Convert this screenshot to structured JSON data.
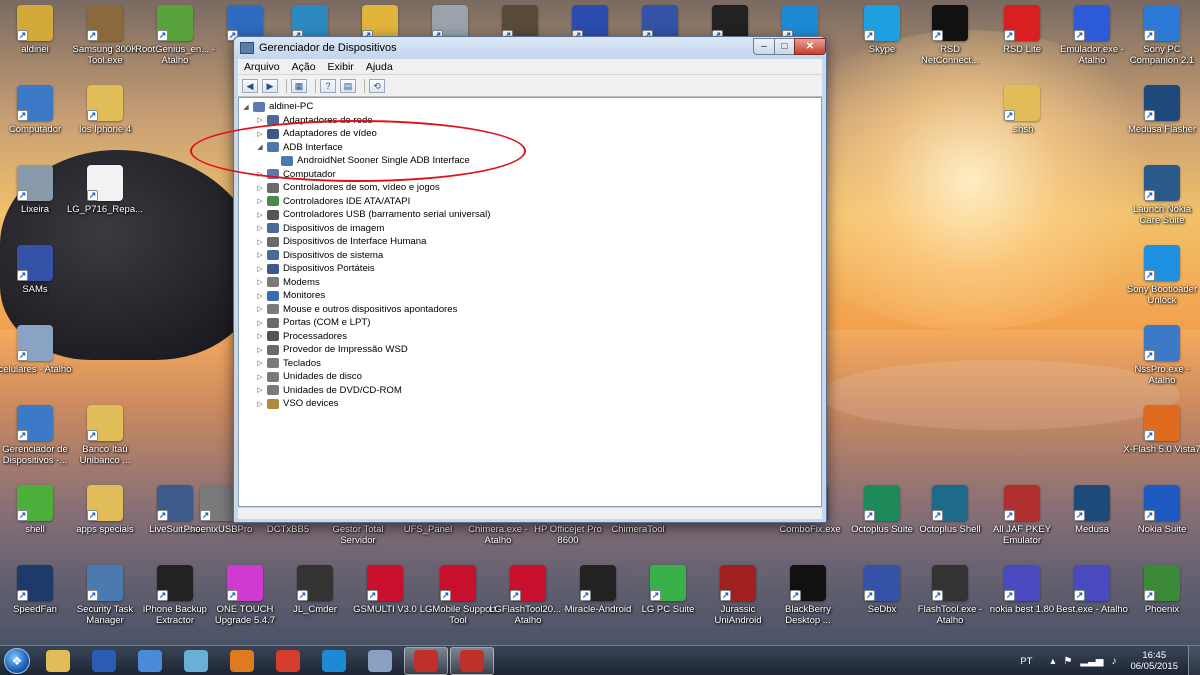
{
  "desktop_icons_left": [
    {
      "label": "aldinei",
      "icon": "user-folder-icon",
      "color": "#d4a93c"
    },
    {
      "label": "Samsung 300K Tool.exe",
      "icon": "resistor-icon",
      "color": "#8a6a3c"
    },
    {
      "label": "RootGenius_en... - Atalho",
      "icon": "android-icon",
      "color": "#5aa33c"
    },
    {
      "label": "Computador",
      "icon": "computer-icon",
      "color": "#3c7ac7"
    },
    {
      "label": "Ios Iphone 4",
      "icon": "folder-icon",
      "color": "#e1bd5a"
    },
    {
      "label": "Lixeira",
      "icon": "recycle-bin-icon",
      "color": "#8a9aab"
    },
    {
      "label": "LG_P716_Repa...",
      "icon": "document-icon",
      "color": "#f2f2f2"
    },
    {
      "label": "SAMs",
      "icon": "ds310-icon",
      "color": "#3352a8"
    },
    {
      "label": "celulares - Atalho",
      "icon": "phone-icon",
      "color": "#8aa2c4"
    },
    {
      "label": "Gerenciador de Dispositivos -...",
      "icon": "device-manager-icon",
      "color": "#3c7ac7"
    },
    {
      "label": "Banco Itaú Unibanco ...",
      "icon": "folder-icon",
      "color": "#e1bd5a"
    },
    {
      "label": "shell",
      "icon": "play-icon",
      "color": "#4caf3c"
    },
    {
      "label": "apps speciais",
      "icon": "folder-icon",
      "color": "#e1bd5a"
    },
    {
      "label": "LiveSuit.exe",
      "icon": "livesuit-icon",
      "color": "#3c5a8a"
    }
  ],
  "desktop_icons_top": [
    {
      "label": "",
      "icon": "anchor-icon",
      "color": "#2d6cc0"
    },
    {
      "label": "",
      "icon": "refresh-lock-icon",
      "color": "#2d8ac0"
    },
    {
      "label": "",
      "icon": "lock-icon",
      "color": "#e1b53c"
    },
    {
      "label": "",
      "icon": "drive-icon",
      "color": "#9aa2ab"
    },
    {
      "label": "",
      "icon": "photo-icon",
      "color": "#5a4a3a"
    },
    {
      "label": "",
      "icon": "download-arrows-icon",
      "color": "#2d4cb0"
    },
    {
      "label": "",
      "icon": "ds310-icon",
      "color": "#3352a8"
    },
    {
      "label": "",
      "icon": "wrench-icon",
      "color": "#222222"
    },
    {
      "label": "",
      "icon": "flash-icon",
      "color": "#1e8ad6"
    },
    {
      "label": "Skype",
      "icon": "skype-icon",
      "color": "#1ea0e0"
    },
    {
      "label": "RSD NetConnect...",
      "icon": "motorola-icon",
      "color": "#111111"
    },
    {
      "label": "RSD Lite",
      "icon": "motorola-red-icon",
      "color": "#d82020"
    },
    {
      "label": "Emulador.exe - Atalho",
      "icon": "building-icon",
      "color": "#2d5ad6"
    },
    {
      "label": "Sony PC Companion 2.1",
      "icon": "sony-phone-icon",
      "color": "#2d7ad6"
    }
  ],
  "desktop_icons_right": [
    {
      "label": ".shsh",
      "icon": "folder-icon",
      "color": "#e1bd5a"
    },
    {
      "label": "Medusa Flasher",
      "icon": "medusa-icon",
      "color": "#1d4a7a"
    },
    {
      "label": "Launch Nokia Care Suite",
      "icon": "nokia-care-icon",
      "color": "#2a5a8a"
    },
    {
      "label": "Sony Bootloader Unlock",
      "icon": "unlock-icon",
      "color": "#1e90e0"
    },
    {
      "label": "NssPro.exe - Atalho",
      "icon": "nss-icon",
      "color": "#3c7ac7"
    },
    {
      "label": "X-Flash 5.0 Vista7",
      "icon": "xflash-icon",
      "color": "#e06a1e"
    },
    {
      "label": "Nokia Suite",
      "icon": "nokia-suite-icon",
      "color": "#1e5ac0"
    }
  ],
  "desktop_row_mid": [
    {
      "label": "PhoenixUSBPro",
      "icon": "app-icon",
      "color": "#7a7a7a"
    },
    {
      "label": "DCTxBB5",
      "icon": "app-icon",
      "color": "#7a7a7a"
    },
    {
      "label": "Gestor Total Servidor",
      "icon": "app-icon",
      "color": "#7a7a7a"
    },
    {
      "label": "UFS_Panel",
      "icon": "app-icon",
      "color": "#7a7a7a"
    },
    {
      "label": "Chimera.exe - Atalho",
      "icon": "app-icon",
      "color": "#7a7a7a"
    },
    {
      "label": "HP Officejet Pro 8600",
      "icon": "printer-icon",
      "color": "#7a7a7a"
    },
    {
      "label": "ChimeraTool",
      "icon": "app-icon",
      "color": "#7a7a7a"
    },
    {
      "label": "ComboFix.exe",
      "icon": "app-icon",
      "color": "#c03030"
    },
    {
      "label": "Octoplus Suite",
      "icon": "octoplus-icon",
      "color": "#1e8a5a"
    },
    {
      "label": "Octoplus Shell",
      "icon": "octoplus-shell-icon",
      "color": "#1e6a8a"
    },
    {
      "label": "All JAF PKEY Emulator",
      "icon": "jaf-icon",
      "color": "#b03030"
    },
    {
      "label": "Medusa",
      "icon": "medusa-icon",
      "color": "#1d4a7a"
    }
  ],
  "desktop_row_bottom": [
    {
      "label": "SpeedFan",
      "icon": "fan-icon",
      "color": "#1e3a6a"
    },
    {
      "label": "Security Task Manager",
      "icon": "magnifier-icon",
      "color": "#4a7ab0"
    },
    {
      "label": "iPhone Backup Extractor",
      "icon": "iphone-icon",
      "color": "#222222"
    },
    {
      "label": "ONE TOUCH Upgrade 5.4.7",
      "icon": "sparkle-icon",
      "color": "#d03ad0"
    },
    {
      "label": "JL_Cmder",
      "icon": "tools-icon",
      "color": "#333333"
    },
    {
      "label": "GSMULTI V3.0",
      "icon": "lg-icon",
      "color": "#c8102e"
    },
    {
      "label": "LGMobile Support Tool",
      "icon": "lg-icon",
      "color": "#c8102e"
    },
    {
      "label": "LGFlashTool20... - Atalho",
      "icon": "lg-icon",
      "color": "#c8102e"
    },
    {
      "label": "Miracle-Android",
      "icon": "wrench-icon",
      "color": "#222222"
    },
    {
      "label": "LG PC Suite",
      "icon": "lg-suite-icon",
      "color": "#3ab04a"
    },
    {
      "label": "Jurassic UniAndroid",
      "icon": "jurassic-icon",
      "color": "#a02020"
    },
    {
      "label": "BlackBerry Desktop ...",
      "icon": "blackberry-icon",
      "color": "#111111"
    },
    {
      "label": "SeDbx",
      "icon": "ds310-icon",
      "color": "#3352a8"
    },
    {
      "label": "FlashTool.exe - Atalho",
      "icon": "lightning-icon",
      "color": "#333333"
    },
    {
      "label": "nokia best 1.80",
      "icon": "nokia-best-icon",
      "color": "#4a4ac0"
    },
    {
      "label": "Best.exe - Atalho",
      "icon": "nokia-best-icon",
      "color": "#4a4ac0"
    },
    {
      "label": "Phoenix",
      "icon": "phoenix-icon",
      "color": "#3a8a3a"
    }
  ],
  "window": {
    "title": "Gerenciador de Dispositivos",
    "menu": [
      "Arquivo",
      "Ação",
      "Exibir",
      "Ajuda"
    ],
    "controls": {
      "minimize": "–",
      "maximize": "□",
      "close": "✕"
    }
  },
  "tree": [
    {
      "level": 0,
      "expander": "◢",
      "label": "aldinei-PC",
      "icon": "computer-icon",
      "color": "#5a7ab0"
    },
    {
      "level": 1,
      "expander": "▷",
      "label": "Adaptadores de rede",
      "icon": "network-icon",
      "color": "#4a6a9a"
    },
    {
      "level": 1,
      "expander": "▷",
      "label": "Adaptadores de vídeo",
      "icon": "display-adapter-icon",
      "color": "#3a5a8a"
    },
    {
      "level": 1,
      "expander": "◢",
      "label": "ADB Interface",
      "icon": "adb-icon",
      "color": "#4a7ab0"
    },
    {
      "level": 2,
      "expander": "",
      "label": "AndroidNet Sooner Single ADB Interface",
      "icon": "adb-icon",
      "color": "#4a7ab0"
    },
    {
      "level": 1,
      "expander": "▷",
      "label": "Computador",
      "icon": "computer-icon",
      "color": "#5a7ab0"
    },
    {
      "level": 1,
      "expander": "▷",
      "label": "Controladores de som, vídeo e jogos",
      "icon": "sound-icon",
      "color": "#6a6a6a"
    },
    {
      "level": 1,
      "expander": "▷",
      "label": "Controladores IDE ATA/ATAPI",
      "icon": "ide-icon",
      "color": "#4a8a4a"
    },
    {
      "level": 1,
      "expander": "▷",
      "label": "Controladores USB (barramento serial universal)",
      "icon": "usb-icon",
      "color": "#555555"
    },
    {
      "level": 1,
      "expander": "▷",
      "label": "Dispositivos de imagem",
      "icon": "camera-icon",
      "color": "#4a6a9a"
    },
    {
      "level": 1,
      "expander": "▷",
      "label": "Dispositivos de Interface Humana",
      "icon": "hid-icon",
      "color": "#6a6a6a"
    },
    {
      "level": 1,
      "expander": "▷",
      "label": "Dispositivos de sistema",
      "icon": "system-icon",
      "color": "#4a6a9a"
    },
    {
      "level": 1,
      "expander": "▷",
      "label": "Dispositivos Portáteis",
      "icon": "portable-icon",
      "color": "#3a5a8a"
    },
    {
      "level": 1,
      "expander": "▷",
      "label": "Modems",
      "icon": "modem-icon",
      "color": "#7a7a7a"
    },
    {
      "level": 1,
      "expander": "▷",
      "label": "Monitores",
      "icon": "monitor-icon",
      "color": "#3a6ab0"
    },
    {
      "level": 1,
      "expander": "▷",
      "label": "Mouse e outros dispositivos apontadores",
      "icon": "mouse-icon",
      "color": "#7a7a7a"
    },
    {
      "level": 1,
      "expander": "▷",
      "label": "Portas (COM e LPT)",
      "icon": "port-icon",
      "color": "#6a6a6a"
    },
    {
      "level": 1,
      "expander": "▷",
      "label": "Processadores",
      "icon": "cpu-icon",
      "color": "#555555"
    },
    {
      "level": 1,
      "expander": "▷",
      "label": "Provedor de Impressão WSD",
      "icon": "printer-icon",
      "color": "#6a6a6a"
    },
    {
      "level": 1,
      "expander": "▷",
      "label": "Teclados",
      "icon": "keyboard-icon",
      "color": "#7a7a7a"
    },
    {
      "level": 1,
      "expander": "▷",
      "label": "Unidades de disco",
      "icon": "disk-icon",
      "color": "#7a7a7a"
    },
    {
      "level": 1,
      "expander": "▷",
      "label": "Unidades de DVD/CD-ROM",
      "icon": "dvd-icon",
      "color": "#7a7a7a"
    },
    {
      "level": 1,
      "expander": "▷",
      "label": "VSO devices",
      "icon": "vso-icon",
      "color": "#b08a3a"
    }
  ],
  "taskbar": {
    "pinned": [
      {
        "icon": "explorer-icon",
        "color": "#e1bd5a"
      },
      {
        "icon": "word-icon",
        "color": "#2b5cb3"
      },
      {
        "icon": "itunes-icon",
        "color": "#4a8ad6"
      },
      {
        "icon": "glass-icon",
        "color": "#6ab0d6"
      },
      {
        "icon": "firefox-icon",
        "color": "#e07a1e"
      },
      {
        "icon": "chrome-icon",
        "color": "#d63c2c"
      },
      {
        "icon": "ie-icon",
        "color": "#1e8ad6"
      },
      {
        "icon": "paint-icon",
        "color": "#8aa0c0"
      },
      {
        "icon": "device-manager-toolbox-icon",
        "color": "#c0302a"
      },
      {
        "icon": "device-manager-toolbox-icon",
        "color": "#c0302a"
      }
    ],
    "language": "PT",
    "time": "16:45",
    "date": "06/05/2015"
  }
}
